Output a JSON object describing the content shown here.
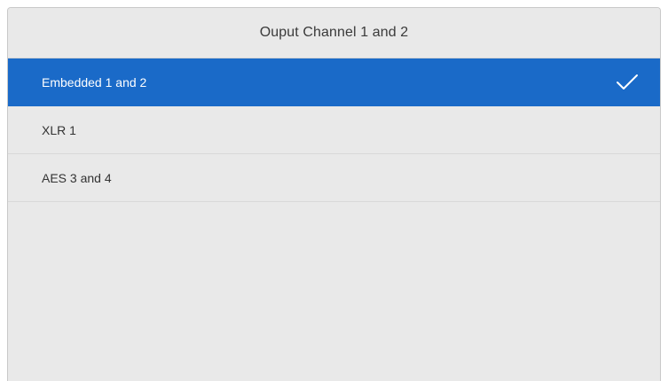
{
  "panel": {
    "title": "Ouput Channel 1 and 2"
  },
  "options": [
    {
      "label": "Embedded 1 and 2",
      "selected": true
    },
    {
      "label": "XLR 1",
      "selected": false
    },
    {
      "label": "AES 3 and 4",
      "selected": false
    }
  ],
  "icons": {
    "selected_indicator": "checkmark-icon"
  },
  "colors": {
    "accent": "#1a6ac8",
    "background": "#e9e9e9",
    "text": "#333333"
  }
}
